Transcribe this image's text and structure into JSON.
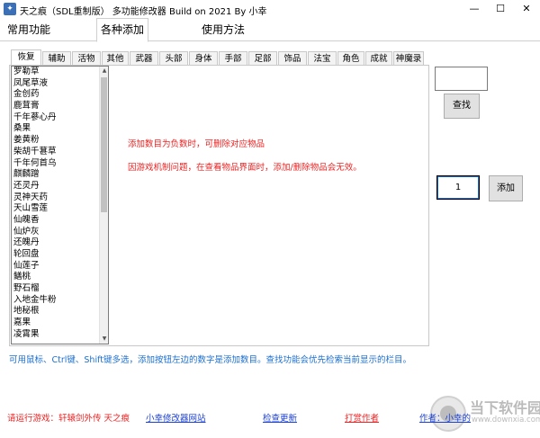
{
  "window": {
    "title": "天之痕（SDL重制版） 多功能修改器  Build on 2021 By 小幸",
    "minimize_glyph": "—",
    "maximize_glyph": "☐",
    "close_glyph": "✕"
  },
  "top_tabs": [
    "常用功能",
    "各种添加",
    "使用方法"
  ],
  "sub_tabs": [
    "恢复",
    "辅助",
    "活物",
    "其他",
    "武器",
    "头部",
    "身体",
    "手部",
    "足部",
    "饰品",
    "法宝",
    "角色",
    "成就",
    "神魔录"
  ],
  "items": [
    "罗勒草",
    "凤尾草液",
    "金创药",
    "鹿茸膏",
    "千年蔘心丹",
    "桑果",
    "姜黄粉",
    "柴胡千葚草",
    "千年何首乌",
    "麒麟蹭",
    "还灵丹",
    "灵神天药",
    "天山雪莲",
    "仙魄香",
    "仙炉灰",
    "还魄丹",
    "轮回盘",
    "仙莲子",
    "鳝桃",
    "野石榴",
    "入地金牛粉",
    "地秘根",
    "嘉果",
    "凌霄果"
  ],
  "notes": {
    "line1": "添加数目为负数时，可删除对应物品",
    "line2": "因游戏机制问题，在查看物品界面时，添加/删除物品会无效。"
  },
  "search": {
    "value": "",
    "button": "查找"
  },
  "add": {
    "quantity": "1",
    "button": "添加"
  },
  "hint": "可用鼠标、Ctrl键、Shift键多选，添加按钮左边的数字是添加数目。查找功能会优先检索当前显示的栏目。",
  "footer": {
    "status": "请运行游戏：轩辕剑外传 天之痕",
    "link_site": "小幸修改器网站",
    "link_update": "检查更新",
    "link_donate": "打赏作者",
    "link_author": "作者：小幸的"
  },
  "watermark": {
    "text": "当下软件园",
    "url": "www.downxia.com"
  },
  "colors": {
    "accent_blue": "#1b6fd1",
    "note_red": "#e22222"
  }
}
